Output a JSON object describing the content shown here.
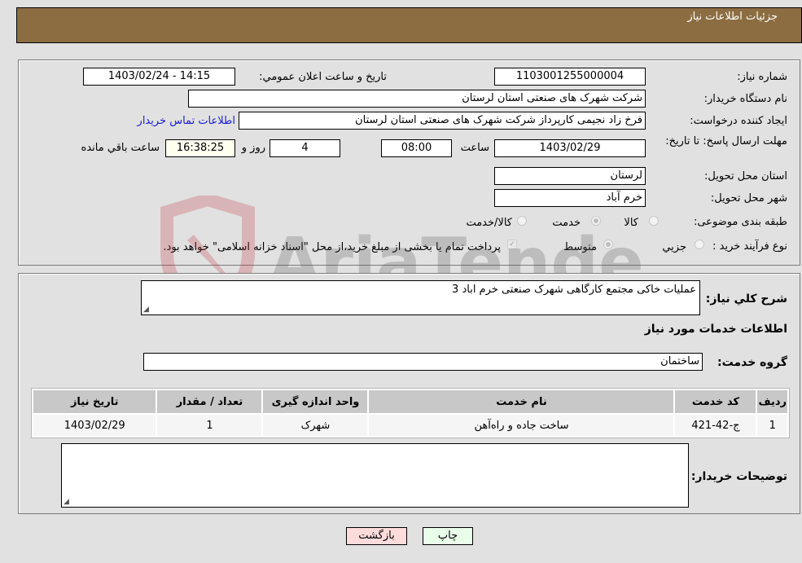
{
  "header": {
    "title": "جزئیات اطلاعات نیاز"
  },
  "info": {
    "need_number_label": "شماره نیاز:",
    "need_number": "1103001255000004",
    "announce_label": "تاریخ و ساعت اعلان عمومي:",
    "announce_value": "1403/02/24 - 14:15",
    "buyer_org_label": "نام دستگاه خریدار:",
    "buyer_org": "شرکت شهرک های صنعتی استان لرستان",
    "creator_label": "ایجاد کننده درخواست:",
    "creator": "فرخ زاد نجیمی کارپرداز شرکت شهرک های صنعتی استان لرستان",
    "contact_link": "اطلاعات تماس خریدار",
    "deadline_label": "مهلت ارسال پاسخ: تا تاریخ:",
    "deadline_date": "1403/02/29",
    "time_label": "ساعت",
    "deadline_time": "08:00",
    "days": "4",
    "days_label": "روز و",
    "remaining_time": "16:38:25",
    "remaining_label": "ساعت باقي مانده",
    "province_label": "استان محل تحویل:",
    "province": "لرستان",
    "city_label": "شهر محل تحویل:",
    "city": "خرم آباد",
    "category_label": "طبقه بندی موضوعی:",
    "category_options": [
      "کالا",
      "خدمت",
      "کالا/خدمت"
    ],
    "category_selected": "خدمت",
    "process_label": "نوع فرآیند خرید :",
    "process_options": [
      "جزیي",
      "متوسط"
    ],
    "process_selected": "متوسط",
    "payment_note": "پرداخت تمام یا بخشی از مبلغ خرید،از محل \"اسناد خزانه اسلامی\" خواهد بود.",
    "payment_checked": true
  },
  "details": {
    "description_label": "شرح کلي نیاز:",
    "description": "عملیات خاکی مجتمع کارگاهی شهرک صنعتی خرم اباد 3",
    "services_heading": "اطلاعات خدمات مورد نیاز",
    "service_group_label": "گروه خدمت:",
    "service_group": "ساختمان",
    "table": {
      "headers": [
        "ردیف",
        "کد خدمت",
        "نام خدمت",
        "واحد اندازه گیری",
        "تعداد / مقدار",
        "تاریخ نیاز"
      ],
      "rows": [
        [
          "1",
          "ج-42-421",
          "ساخت جاده و راه‌آهن",
          "شهرک",
          "1",
          "1403/02/29"
        ]
      ]
    },
    "buyer_notes_label": "توضیحات خریدار:",
    "buyer_notes": ""
  },
  "buttons": {
    "print": "چاپ",
    "back": "بازگشت"
  },
  "watermark": {
    "text": "AriaTender.neT"
  },
  "colors": {
    "header_bg": "#8c6d42",
    "print_bg": "#eaffea",
    "back_bg": "#ffdcdc",
    "link": "#1b1bd6"
  }
}
